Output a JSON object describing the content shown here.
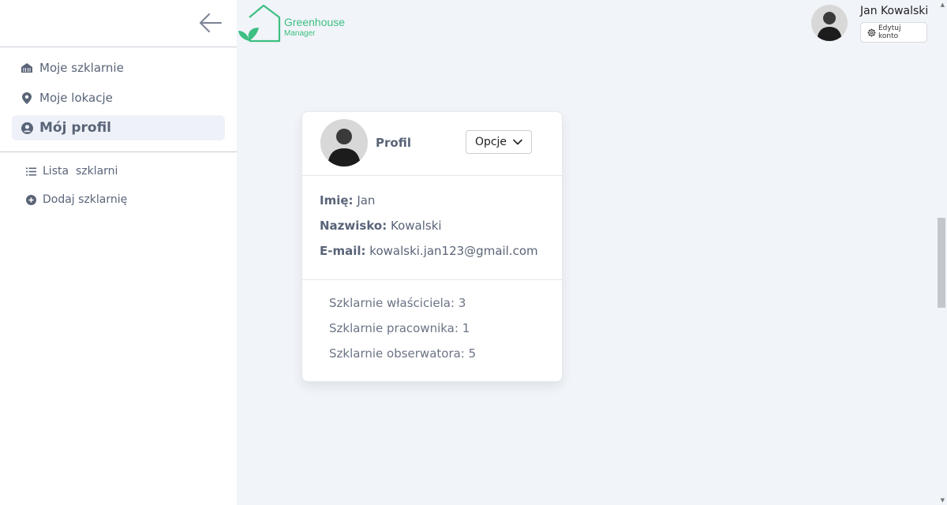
{
  "app": {
    "logo_title": "Greenhouse",
    "logo_subtitle": "Manager",
    "brand_color": "#3dbf82"
  },
  "user": {
    "name": "Jan Kowalski",
    "edit_account_label": "Edytuj konto"
  },
  "sidebar": {
    "items": [
      {
        "label": "Moje szklarnie",
        "icon": "greenhouse-icon"
      },
      {
        "label": "Moje lokacje",
        "icon": "location-pin-icon"
      },
      {
        "label": "Mój profil",
        "icon": "user-circle-icon",
        "active": true
      }
    ],
    "sub_items": [
      {
        "label": "Lista  szklarni",
        "icon": "list-icon"
      },
      {
        "label": "Dodaj szklarnię",
        "icon": "plus-circle-icon"
      }
    ]
  },
  "profile_card": {
    "title": "Profil",
    "options_label": "Opcje",
    "fields": [
      {
        "label": "Imię:",
        "value": "Jan"
      },
      {
        "label": "Nazwisko:",
        "value": "Kowalski"
      },
      {
        "label": "E-mail:",
        "value": "kowalski.jan123@gmail.com"
      }
    ],
    "stats": [
      {
        "label": "Szklarnie właściciela:",
        "value": "3"
      },
      {
        "label": "Szklarnie pracownika:",
        "value": "1"
      },
      {
        "label": "Szklarnie obserwatora:",
        "value": "5"
      }
    ]
  }
}
